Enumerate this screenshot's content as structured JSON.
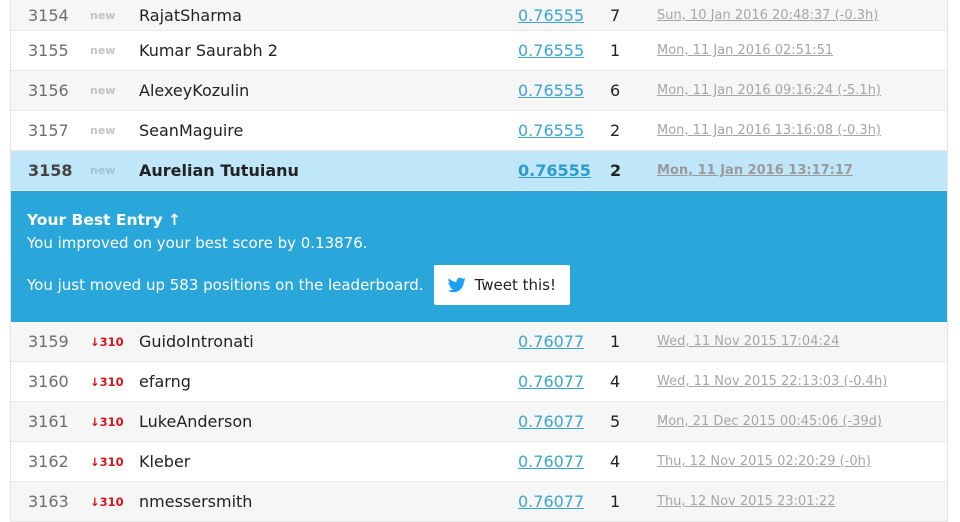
{
  "colors": {
    "accent": "#29a7da",
    "highlight_row": "#bfe7f9",
    "down_delta": "#d4151b",
    "score_link": "#3ba5d3"
  },
  "rows_top": [
    {
      "rank": "3154",
      "delta": "new",
      "team": "RajatSharma",
      "score": "0.76555",
      "entries": "7",
      "last": "Sun, 10 Jan 2016 20:48:37 (-0.3h)"
    },
    {
      "rank": "3155",
      "delta": "new",
      "team": "Kumar Saurabh 2",
      "score": "0.76555",
      "entries": "1",
      "last": "Mon, 11 Jan 2016 02:51:51"
    },
    {
      "rank": "3156",
      "delta": "new",
      "team": "AlexeyKozulin",
      "score": "0.76555",
      "entries": "6",
      "last": "Mon, 11 Jan 2016 09:16:24 (-5.1h)"
    },
    {
      "rank": "3157",
      "delta": "new",
      "team": "SeanMaguire",
      "score": "0.76555",
      "entries": "2",
      "last": "Mon, 11 Jan 2016 13:16:08 (-0.3h)"
    }
  ],
  "my_row": {
    "rank": "3158",
    "delta": "new",
    "team": "Aurelian Tutuianu",
    "score": "0.76555",
    "entries": "2",
    "last": "Mon, 11 Jan 2016 13:17:17"
  },
  "banner": {
    "title": "Your Best Entry ↑",
    "improved": "You improved on your best score by 0.13876.",
    "moved": "You just moved up 583 positions on the leaderboard.",
    "tweet_label": "Tweet this!",
    "tweet_icon": "twitter-bird-icon"
  },
  "rows_bottom": [
    {
      "rank": "3159",
      "delta": "↓310",
      "team": "GuidoIntronati",
      "score": "0.76077",
      "entries": "1",
      "last": "Wed, 11 Nov 2015 17:04:24"
    },
    {
      "rank": "3160",
      "delta": "↓310",
      "team": "efarng",
      "score": "0.76077",
      "entries": "4",
      "last": "Wed, 11 Nov 2015 22:13:03 (-0.4h)"
    },
    {
      "rank": "3161",
      "delta": "↓310",
      "team": "LukeAnderson",
      "score": "0.76077",
      "entries": "5",
      "last": "Mon, 21 Dec 2015 00:45:06 (-39d)"
    },
    {
      "rank": "3162",
      "delta": "↓310",
      "team": "Kleber",
      "score": "0.76077",
      "entries": "4",
      "last": "Thu, 12 Nov 2015 02:20:29 (-0h)"
    },
    {
      "rank": "3163",
      "delta": "↓310",
      "team": "nmessersmith",
      "score": "0.76077",
      "entries": "1",
      "last": "Thu, 12 Nov 2015 23:01:22"
    }
  ]
}
